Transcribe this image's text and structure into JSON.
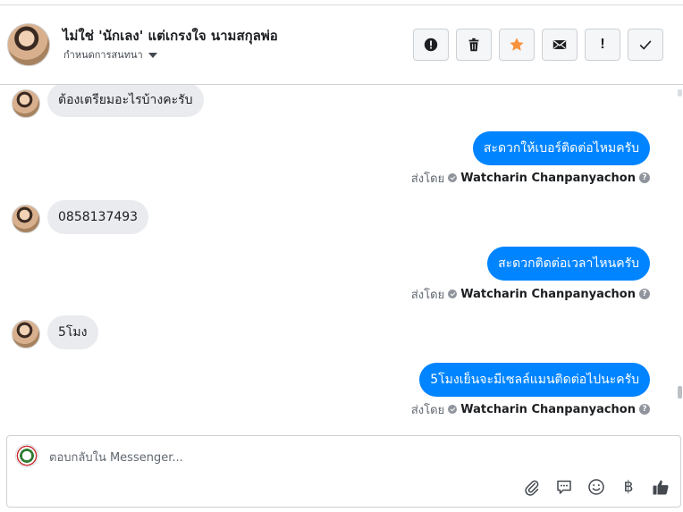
{
  "header": {
    "name": "ไม่ใช่ 'นักเลง' แต่เกรงใจ นามสกุลพ่อ",
    "subtitle": "กำหนดการสนทนา",
    "actions": [
      {
        "icon": "alert-icon"
      },
      {
        "icon": "trash-icon"
      },
      {
        "icon": "star-icon",
        "color": "#f7923b"
      },
      {
        "icon": "envelope-icon"
      },
      {
        "icon": "exclamation-icon",
        "label": "!"
      },
      {
        "icon": "checkmark-icon"
      }
    ]
  },
  "messages": [
    {
      "direction": "in",
      "text": "ต้องเตรียมอะไรบ้างคะรับ"
    },
    {
      "direction": "out",
      "text": "สะดวกให้เบอร์ติดต่อไหมครับ",
      "sent_by_prefix": "ส่งโดย",
      "sender": "Watcharin Chanpanyachon"
    },
    {
      "direction": "in",
      "text": "0858137493"
    },
    {
      "direction": "out",
      "text": "สะดวกติดต่อเวลาไหนครับ",
      "sent_by_prefix": "ส่งโดย",
      "sender": "Watcharin Chanpanyachon"
    },
    {
      "direction": "in",
      "text": "5โมง"
    },
    {
      "direction": "out",
      "text": "5โมงเย็นจะมีเซลล์แมนติดต่อไปนะครับ",
      "sent_by_prefix": "ส่งโดย",
      "sender": "Watcharin Chanpanyachon"
    }
  ],
  "composer": {
    "placeholder": "ตอบกลับใน Messenger...",
    "tools": [
      {
        "icon": "paperclip-icon"
      },
      {
        "icon": "saved-reply-icon"
      },
      {
        "icon": "emoji-icon"
      },
      {
        "icon": "baht-icon",
        "label": "฿"
      },
      {
        "icon": "thumbs-up-icon"
      }
    ]
  },
  "colors": {
    "outgoing_bubble": "#0084ff",
    "incoming_bubble": "#e9ebee",
    "star": "#f7923b"
  }
}
